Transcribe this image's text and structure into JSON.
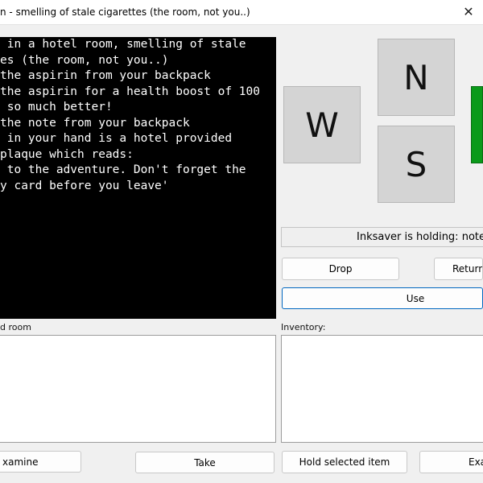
{
  "window": {
    "title": "n - smelling of stale cigarettes (the room, not you..)",
    "close_glyph": "✕"
  },
  "console": {
    "lines": [
      " in a hotel room, smelling of stale",
      "es (the room, not you..)",
      "the aspirin from your backpack",
      "the aspirin for a health boost of 100",
      " so much better!",
      "the note from your backpack",
      " in your hand is a hotel provided",
      "plaque which reads:",
      " to the adventure. Don't forget the",
      "y card before you leave'"
    ]
  },
  "directions": {
    "north": "N",
    "west": "W",
    "south": "S"
  },
  "status": {
    "text": "Inksaver is holding: note"
  },
  "buttons": {
    "drop": "Drop",
    "return": "Return t",
    "use": "Use",
    "examine": "xamine",
    "take": "Take",
    "hold_selected": "Hold selected item",
    "examine_right": "Exa"
  },
  "labels": {
    "room": "d room",
    "inventory": "Inventory:"
  },
  "colors": {
    "console_bg": "#000000",
    "console_text": "#ffffff",
    "east_button": "#0a9a1a",
    "focus_border": "#0067c0"
  }
}
